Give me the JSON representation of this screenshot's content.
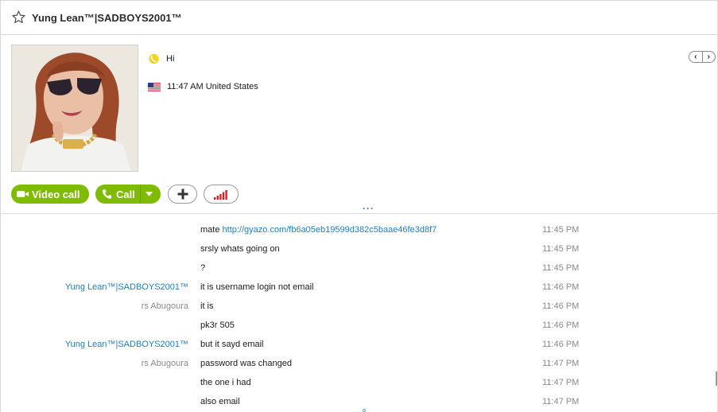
{
  "header": {
    "title": "Yung Lean™|SADBOYS2001™",
    "star_icon": "star-outline-icon"
  },
  "profile": {
    "mood_icon": "skype-status-icon",
    "mood_text": "Hi",
    "flag_icon": "us-flag-icon",
    "local_time": "11:47 AM United States"
  },
  "nav": {
    "prev_label": "‹",
    "next_label": "›"
  },
  "actions": {
    "video_call_label": "Video call",
    "call_label": "Call",
    "add_icon": "plus-icon",
    "signal_icon": "call-quality-icon",
    "accent_color": "#7fbb00"
  },
  "chat": {
    "messages": [
      {
        "sender": "",
        "text": "mate ",
        "link": "http://gyazo.com/fb6a05eb19599d382c5baae46fe3d8f7",
        "time": "11:45 PM"
      },
      {
        "sender": "",
        "text": "srsly whats going on",
        "link": "",
        "time": "11:45 PM"
      },
      {
        "sender": "",
        "text": "?",
        "link": "",
        "time": "11:45 PM"
      },
      {
        "sender": "Yung Lean™|SADBOYS2001™",
        "text": "it is username login not email",
        "link": "",
        "time": "11:46 PM"
      },
      {
        "sender": "rs Abugoura",
        "text": "it is",
        "link": "",
        "time": "11:46 PM"
      },
      {
        "sender": "",
        "text": "pk3r 505",
        "link": "",
        "time": "11:46 PM"
      },
      {
        "sender": "Yung Lean™|SADBOYS2001™",
        "text": "but it sayd email",
        "link": "",
        "time": "11:46 PM"
      },
      {
        "sender": "rs Abugoura",
        "text": "password was changed",
        "link": "",
        "time": "11:47 PM"
      },
      {
        "sender": "",
        "text": "the one i had",
        "link": "",
        "time": "11:47 PM"
      },
      {
        "sender": "",
        "text": "also email",
        "link": "",
        "time": "11:47 PM"
      }
    ]
  }
}
